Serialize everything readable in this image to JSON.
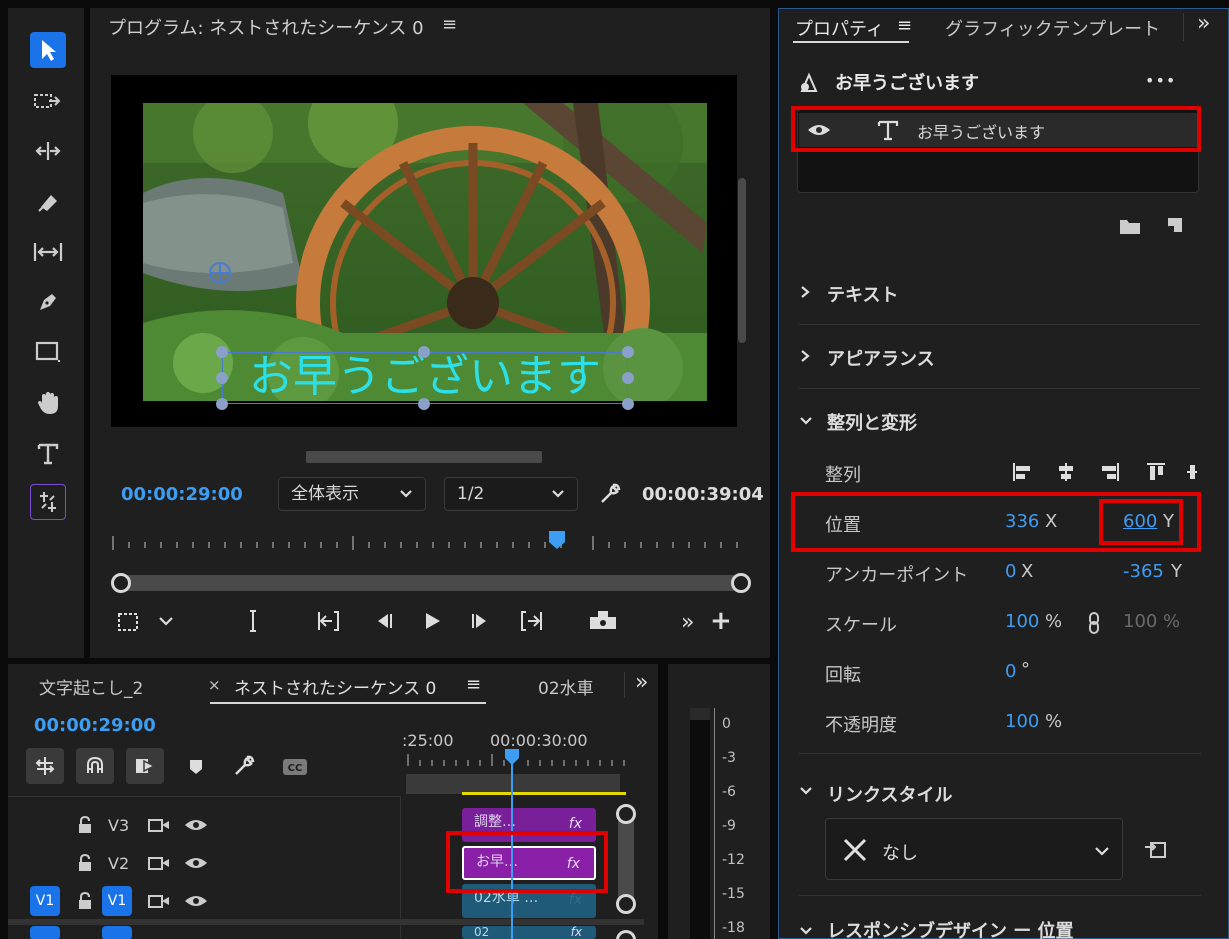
{
  "program": {
    "title": "プログラム: ネストされたシーケンス 0",
    "menu_glyph": "≡",
    "overlay_text": "お早うございます",
    "current_time": "00:00:29:00",
    "fit_label": "全体表示",
    "resolution_label": "1/2",
    "duration": "00:00:39:04",
    "accent": "#3d9df3"
  },
  "tools": [
    {
      "name": "selection-tool-icon"
    },
    {
      "name": "track-select-tool-icon"
    },
    {
      "name": "ripple-edit-tool-icon"
    },
    {
      "name": "razor-tool-icon"
    },
    {
      "name": "slip-tool-icon"
    },
    {
      "name": "pen-tool-icon"
    },
    {
      "name": "rectangle-tool-icon"
    },
    {
      "name": "hand-tool-icon"
    },
    {
      "name": "type-tool-icon"
    },
    {
      "name": "remix-tool-icon"
    }
  ],
  "timeline": {
    "tabs": [
      "文字起こし_2",
      "ネストされたシーケンス 0",
      "02水車"
    ],
    "close_glyph": "×",
    "menu_glyph": "≡",
    "more_glyph": "»",
    "timecode": "00:00:29:00",
    "ruler_labels": [
      ":25:00",
      "00:00:30:00"
    ],
    "tracks": [
      {
        "name": "V3"
      },
      {
        "name": "V2"
      },
      {
        "name": "V1",
        "source": "V1"
      }
    ],
    "clips": [
      {
        "label": "調整…",
        "fx": "fx"
      },
      {
        "label": "お早…",
        "fx": "fx"
      },
      {
        "label": "02水車 …",
        "fx": "fx"
      },
      {
        "label": "02",
        "fx": "fx"
      }
    ]
  },
  "meters": {
    "scale": [
      "0",
      "-3",
      "-6",
      "-9",
      "-12",
      "-15",
      "-18"
    ]
  },
  "properties": {
    "tabs": [
      "プロパティ",
      "グラフィックテンプレート"
    ],
    "tab_menu_glyph": "≡",
    "more_glyph": "»",
    "layer_title": "お早うございます",
    "ellipsis": "•••",
    "layer_item": "お早うございます",
    "sections": {
      "text": "テキスト",
      "appearance": "アピアランス",
      "align_transform": "整列と変形",
      "link_style": "リンクスタイル",
      "responsive": "レスポンシブデザイン ー 位置"
    },
    "transform": {
      "align_label": "整列",
      "position_label": "位置",
      "position_x": "336",
      "position_y": "600",
      "anchor_label": "アンカーポイント",
      "anchor_x": "0",
      "anchor_y": "-365",
      "scale_label": "スケール",
      "scale_value": "100",
      "scale_locked_value": "100",
      "rotation_label": "回転",
      "rotation_value": "0",
      "opacity_label": "不透明度",
      "opacity_value": "100",
      "x_axis": "X",
      "y_axis": "Y",
      "percent": "%",
      "degree": "°"
    },
    "link_style_value": "なし"
  }
}
